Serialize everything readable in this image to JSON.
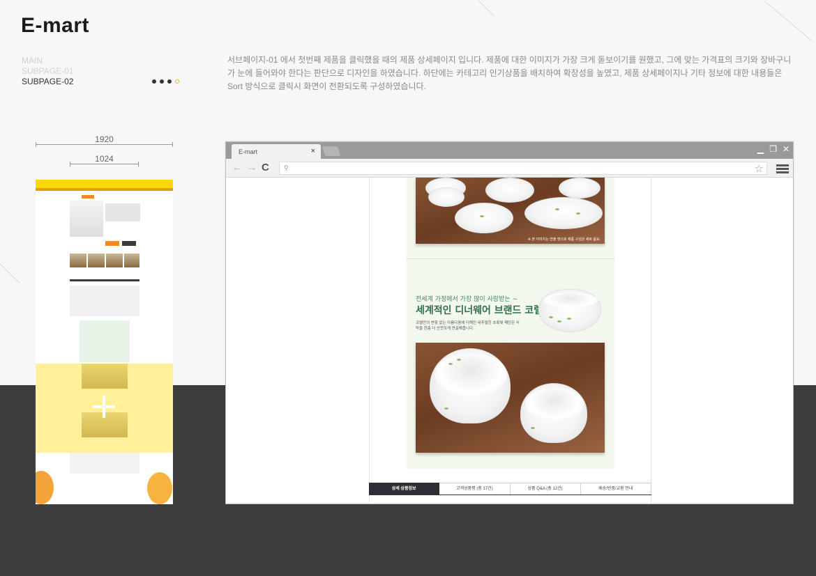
{
  "project_title": "E-mart",
  "nav": {
    "items": [
      {
        "label": "MAIN",
        "active": false
      },
      {
        "label": "SUBPAGE-01",
        "active": false
      },
      {
        "label": "SUBPAGE-02",
        "active": true
      }
    ],
    "page_dots_total": 4,
    "page_dots_current": 4
  },
  "description": "서브페이지-01 에서 첫번째 제품을 클릭했을 때의 제품 상세페이지 입니다. 제품에 대한 이미지가 가장 크게 돋보이기를 원했고, 그에 맞는 가격표의 크기와 장바구니가 눈에 들어와야 한다는 판단으로 디자인을 하였습니다. 하단에는 카테고리 인기상품을 배치하여 확장성을 높였고, 제품 상세페이지나 기타 정보에 대한 내용들은 Sort 방식으로 클릭시 화면이 전환되도록 구성하였습니다.",
  "dimensions": {
    "outer": "1920",
    "inner": "1024"
  },
  "browser": {
    "tab_title": "E-mart",
    "tab_close": "×",
    "minimize": "▁",
    "restore": "❐",
    "close": "✕",
    "back": "←",
    "forward": "→",
    "reload": "C",
    "address": "",
    "star": "☆"
  },
  "product_page": {
    "photo_caption": "※ 본 이미지는 연출 컷으로 제품 구성은 새로 봄요.",
    "tagline": "전세계 가정에서 가장 많이 사랑받는 ~",
    "headline": "세계적인 디너웨어 브랜드 코렐",
    "description": "코렐만의 변함 없는 아름다움에 더해진 내추럴한 초록빛 패턴은 식탁을 한층 더 산뜻하게 연출해줍니다.",
    "tabs": [
      {
        "label": "상세 상품정보",
        "active": true
      },
      {
        "label": "고객상품평 (총 17건)",
        "active": false
      },
      {
        "label": "상품 Q&A (총 12건)",
        "active": false
      },
      {
        "label": "배송/반품/교환 안내",
        "active": false
      }
    ]
  },
  "colors": {
    "accent_yellow": "#ffd700",
    "dark_band": "#3d3d3d",
    "brand_green": "#2f7048",
    "tab_active": "#2e2f35"
  }
}
